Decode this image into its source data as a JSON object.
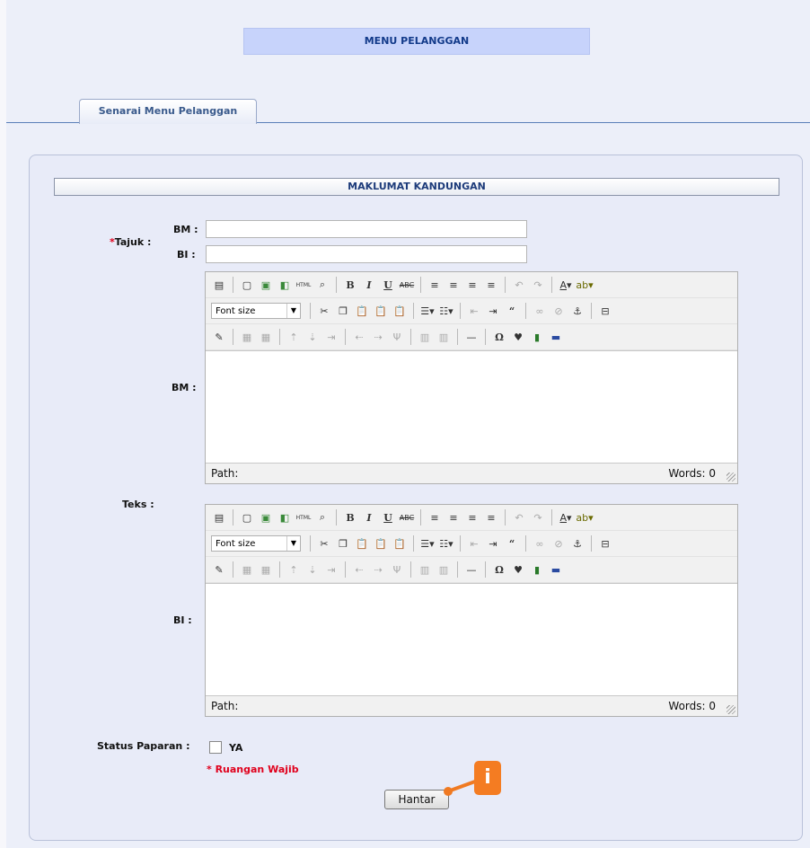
{
  "header": {
    "menu_title": "MENU PELANGGAN",
    "tab_label": "Senarai Menu Pelanggan"
  },
  "section": {
    "title": "MAKLUMAT KANDUNGAN"
  },
  "form": {
    "tajuk_label": "Tajuk :",
    "required_mark": "*",
    "bm_label": "BM :",
    "bi_label": "BI :",
    "bm_value": "",
    "bi_value": "",
    "teks_label": "Teks :",
    "status_label": "Status Paparan :",
    "status_option": "YA",
    "required_note": "* Ruangan Wajib",
    "submit_label": "Hantar"
  },
  "editor": {
    "font_size_label": "Font size",
    "path_label": "Path:",
    "words_label": "Words: 0"
  },
  "callout": {
    "label": "i",
    "color": "#f47c22"
  }
}
